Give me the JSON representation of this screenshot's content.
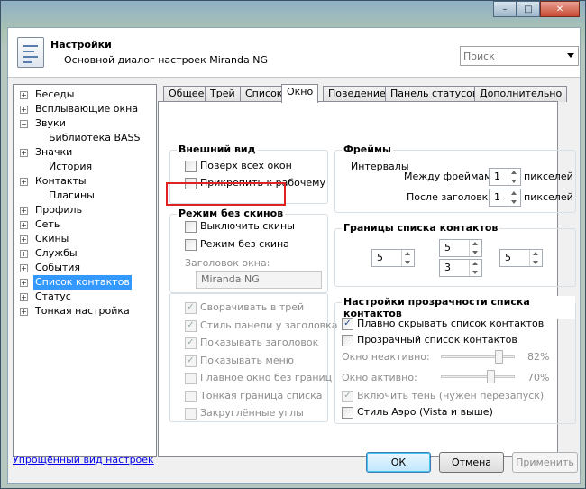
{
  "window": {
    "minimize": "–",
    "maximize": "□",
    "close": "✕"
  },
  "header": {
    "title": "Настройки",
    "subtitle": "Основной диалог настроек Miranda NG",
    "icon": "settings-list-icon"
  },
  "search": {
    "placeholder": "Поиск"
  },
  "tree": {
    "items": [
      {
        "label": "Беседы",
        "expander": "+"
      },
      {
        "label": "Всплывающие окна",
        "expander": "+"
      },
      {
        "label": "Звуки",
        "expander": "−"
      },
      {
        "label": "Библиотека BASS",
        "expander": ""
      },
      {
        "label": "Значки",
        "expander": "+"
      },
      {
        "label": "История",
        "expander": ""
      },
      {
        "label": "Контакты",
        "expander": "+"
      },
      {
        "label": "Плагины",
        "expander": ""
      },
      {
        "label": "Профиль",
        "expander": "+"
      },
      {
        "label": "Сеть",
        "expander": "+"
      },
      {
        "label": "Скины",
        "expander": "+"
      },
      {
        "label": "Службы",
        "expander": "+"
      },
      {
        "label": "События",
        "expander": "+"
      },
      {
        "label": "Список контактов",
        "expander": "+"
      },
      {
        "label": "Статус",
        "expander": "+"
      },
      {
        "label": "Тонкая настройка",
        "expander": "+"
      }
    ],
    "selected": "Список контактов"
  },
  "tabs": [
    "Общее",
    "Трей",
    "Список",
    "Окно",
    "Поведение",
    "Панель статусов",
    "Дополнительно"
  ],
  "active_tab": "Окно",
  "appearance": {
    "title": "Внешний вид",
    "opts": [
      {
        "label": "Поверх всех окон",
        "checked": false
      },
      {
        "label": "Прикрепить к рабочему сто",
        "checked": false
      }
    ]
  },
  "skinless": {
    "title": "Режим без скинов",
    "opts": [
      {
        "label": "Выключить скины",
        "checked": false
      },
      {
        "label": "Режим без скина",
        "checked": false
      }
    ],
    "caption_label": "Заголовок окна:",
    "caption_value": "Miranda NG"
  },
  "window_opts": [
    {
      "label": "Сворачивать в трей",
      "checked": true
    },
    {
      "label": "Стиль панели у заголовка",
      "checked": true
    },
    {
      "label": "Показывать заголовок",
      "checked": true
    },
    {
      "label": "Показывать меню",
      "checked": true
    },
    {
      "label": "Главное окно без границ",
      "checked": false
    },
    {
      "label": "Тонкая граница списка",
      "checked": false
    },
    {
      "label": "Закруглённые углы",
      "checked": false
    }
  ],
  "frames": {
    "title": "Фреймы",
    "intervals": "Интервалы",
    "between_label": "Между фреймами",
    "between_value": "1",
    "after_label": "После заголовка",
    "after_value": "1",
    "unit": "пикселей"
  },
  "borders": {
    "title": "Границы списка контактов",
    "left": "5",
    "top": "5",
    "bottom": "3",
    "right": "5"
  },
  "transparency": {
    "title": "Настройки прозрачности списка контактов",
    "opts": [
      {
        "label": "Плавно скрывать список контактов",
        "checked": true
      },
      {
        "label": "Прозрачный список контактов",
        "checked": false
      }
    ],
    "inactive_label": "Окно неактивно:",
    "inactive_value": "82%",
    "inactive_level": 0.82,
    "active_label": "Окно активно:",
    "active_value": "70%",
    "active_level": 0.7,
    "shadow": {
      "label": "Включить тень (нужен перезапуск)",
      "checked": true
    },
    "aero": {
      "label": "Стиль Аэро (Vista и выше)",
      "checked": false
    }
  },
  "footer": {
    "simple_link": "Упрощённый вид настроек",
    "ok": "ОК",
    "cancel": "Отмена",
    "apply": "Применить"
  }
}
